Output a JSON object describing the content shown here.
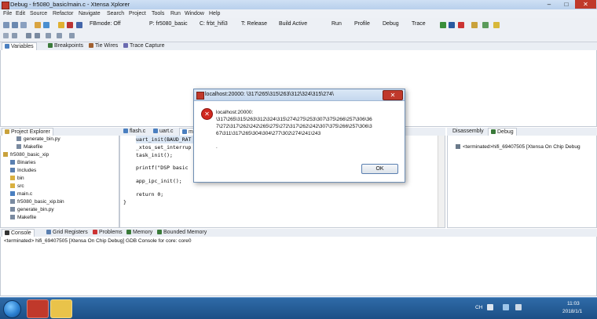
{
  "window": {
    "title": "Debug - fr5080_basic/main.c - Xtensa Xplorer",
    "controls": {
      "minimize": "–",
      "maximize": "□",
      "close": "✕"
    }
  },
  "menu": [
    "File",
    "Edit",
    "Source",
    "Refactor",
    "Navigate",
    "Search",
    "Project",
    "Tools",
    "Run",
    "Window",
    "Help"
  ],
  "toolbar": {
    "fbmode": "FBmode: Off",
    "project": "P: fr5080_basic",
    "config": "C: frbt_hifi3",
    "target": "T: Release",
    "build": "Build Active",
    "run": "Run",
    "profile": "Profile",
    "debug": "Debug",
    "trace": "Trace"
  },
  "top_tabs": [
    "Variables",
    "Breakpoints",
    "Tie Wires",
    "Trace Capture"
  ],
  "project_explorer": {
    "tab": "Project Explorer",
    "items": [
      {
        "label": "generate_bin.py",
        "indent": 2,
        "kind": "file"
      },
      {
        "label": "Makefile",
        "indent": 2,
        "kind": "file"
      },
      {
        "label": "fr5080_basic_xip",
        "indent": 0,
        "kind": "project"
      },
      {
        "label": "Binaries",
        "indent": 1,
        "kind": "folder"
      },
      {
        "label": "Includes",
        "indent": 1,
        "kind": "folder"
      },
      {
        "label": "bin",
        "indent": 1,
        "kind": "folder"
      },
      {
        "label": "src",
        "indent": 1,
        "kind": "folder"
      },
      {
        "label": "main.c",
        "indent": 1,
        "kind": "file"
      },
      {
        "label": "fr5080_basic_xip.bin",
        "indent": 1,
        "kind": "file"
      },
      {
        "label": "generate_bin.py",
        "indent": 1,
        "kind": "file"
      },
      {
        "label": "Makefile",
        "indent": 1,
        "kind": "file"
      }
    ]
  },
  "editor": {
    "tabs": [
      "flash.c",
      "uart.c",
      "ma"
    ],
    "lines": [
      "uart_init(BAUD_RAT",
      "_xtos_set_interrup",
      "task_init();",
      "",
      "printf(\"DSP basic",
      "",
      "app_ipc_init();",
      "",
      "return 0;",
      "}"
    ]
  },
  "debug_panel": {
    "tabs": [
      "Disassembly",
      "Debug"
    ],
    "item": "<terminated>hifi_69407505 [Xtensa On Chip Debug"
  },
  "console": {
    "tabs": [
      "Console",
      "Grid Registers",
      "Problems",
      "Memory",
      "Bounded Memory"
    ],
    "text": "<terminated> hifi_69407505 [Xtensa On Chip Debug] GDB Console for core: core0"
  },
  "dialog": {
    "title": "localhost:20000: \\317\\265\\315\\263\\312\\324\\315\\274\\",
    "lines": [
      "localhost:20000:",
      "\\317\\265\\315\\263\\312\\324\\315\\274\\275\\253\\307\\375\\266\\257\\306\\36",
      "7\\272\\317\\262\\242\\265\\275\\272\\317\\262\\242\\307\\375\\266\\257\\306\\3",
      "67\\311\\317\\265\\304\\304\\277\\302\\274\\241\\243",
      "."
    ],
    "ok": "OK",
    "close": "✕",
    "error_glyph": "✕"
  },
  "taskbar": {
    "lang": "CH",
    "time": "11:03",
    "date": "2018/1/1"
  }
}
